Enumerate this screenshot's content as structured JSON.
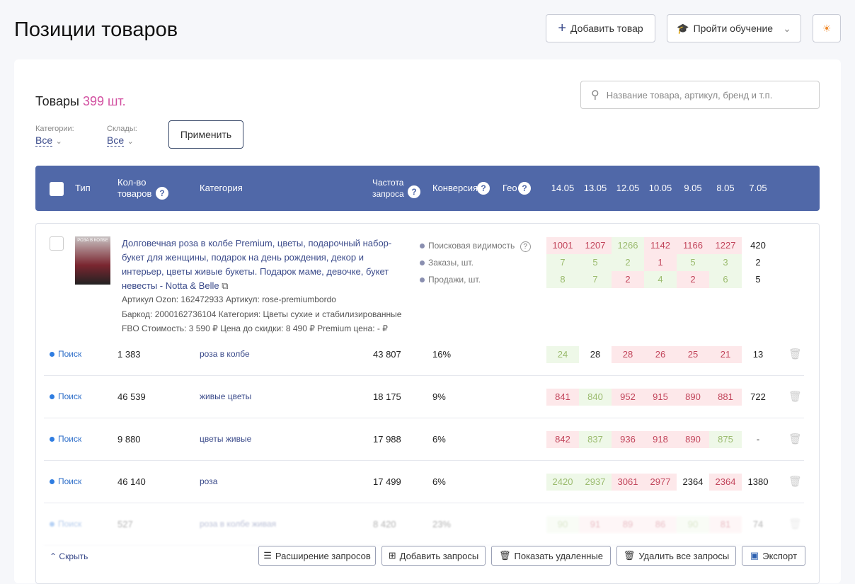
{
  "header": {
    "title": "Позиции товаров",
    "add_product": "Добавить товар",
    "training": "Пройти обучение"
  },
  "products": {
    "label": "Товары",
    "count": "399 шт.",
    "search_placeholder": "Название товара, артикул, бренд и т.п.",
    "categories_label": "Категории:",
    "categories_value": "Все",
    "warehouses_label": "Склады:",
    "warehouses_value": "Все",
    "apply": "Применить"
  },
  "table_header": {
    "type": "Тип",
    "qty": "Кол-во товаров",
    "category": "Категория",
    "frequency": "Частота запроса",
    "conversion": "Конверсия",
    "geo": "Гео",
    "dates": [
      "14.05",
      "13.05",
      "12.05",
      "10.05",
      "9.05",
      "8.05",
      "7.05"
    ]
  },
  "product": {
    "title": "Долговечная роза в колбе Premium, цветы, подарочный набор-букет для женщины, подарок на день рождения, декор и интерьер, цветы живые букеты. Подарок маме, девочке, букет невесты - Notta & Belle",
    "line1": "Артикул Ozon: 162472933   Артикул: rose-premiumbordo",
    "line2": "Баркод: 2000162736104 Категория: Цветы сухие и стабилизированные",
    "line3": "FBO Стоимость: 3 590 ₽ Цена до скидки: 8 490 ₽ Premium цена: - ₽",
    "image_text": "РОЗА В КОЛБЕ",
    "metrics": [
      {
        "label": "Поисковая видимость",
        "values": [
          "1001",
          "1207",
          "1266",
          "1142",
          "1166",
          "1227",
          "420"
        ],
        "tones": [
          "r",
          "r",
          "g",
          "r",
          "r",
          "r",
          "n"
        ]
      },
      {
        "label": "Заказы, шт.",
        "values": [
          "7",
          "5",
          "2",
          "1",
          "5",
          "3",
          "2"
        ],
        "tones": [
          "g",
          "g",
          "g",
          "r",
          "g",
          "g",
          "n"
        ]
      },
      {
        "label": "Продажи, шт.",
        "values": [
          "8",
          "7",
          "2",
          "4",
          "2",
          "6",
          "5"
        ],
        "tones": [
          "g",
          "g",
          "r",
          "g",
          "r",
          "g",
          "n"
        ]
      }
    ]
  },
  "rows": [
    {
      "type": "Поиск",
      "qty": "1 383",
      "category": "роза в колбе",
      "frequency": "43 807",
      "conversion": "16%",
      "values": [
        "24",
        "28",
        "28",
        "26",
        "25",
        "21",
        "13"
      ],
      "tones": [
        "g",
        "n",
        "r",
        "r",
        "r",
        "r",
        "n"
      ]
    },
    {
      "type": "Поиск",
      "qty": "46 539",
      "category": "живые цветы",
      "frequency": "18 175",
      "conversion": "9%",
      "values": [
        "841",
        "840",
        "952",
        "915",
        "890",
        "881",
        "722"
      ],
      "tones": [
        "r",
        "g",
        "r",
        "r",
        "r",
        "r",
        "n"
      ]
    },
    {
      "type": "Поиск",
      "qty": "9 880",
      "category": "цветы живые",
      "frequency": "17 988",
      "conversion": "6%",
      "values": [
        "842",
        "837",
        "936",
        "918",
        "890",
        "875",
        "-"
      ],
      "tones": [
        "r",
        "g",
        "r",
        "r",
        "r",
        "g",
        "n"
      ]
    },
    {
      "type": "Поиск",
      "qty": "46 140",
      "category": "роза",
      "frequency": "17 499",
      "conversion": "6%",
      "values": [
        "2420",
        "2937",
        "3061",
        "2977",
        "2364",
        "2364",
        "1380"
      ],
      "tones": [
        "g",
        "g",
        "r",
        "r",
        "n",
        "r",
        "n"
      ]
    },
    {
      "type": "Поиск",
      "qty": "527",
      "category": "роза в колбе живая",
      "frequency": "8 420",
      "conversion": "23%",
      "values": [
        "90",
        "91",
        "89",
        "86",
        "90",
        "81",
        "74"
      ],
      "tones": [
        "g",
        "r",
        "r",
        "r",
        "g",
        "r",
        "n"
      ]
    }
  ],
  "footer": {
    "hide": "Скрыть",
    "expand": "Расширение запросов",
    "add": "Добавить запросы",
    "show_deleted": "Показать удаленные",
    "delete_all": "Удалить все запросы",
    "export": "Экспорт"
  },
  "colors": {
    "accent": "#5068a8",
    "count": "#d24fa0",
    "red_bg": "#fde8ea",
    "green_bg": "#eef8e8"
  }
}
